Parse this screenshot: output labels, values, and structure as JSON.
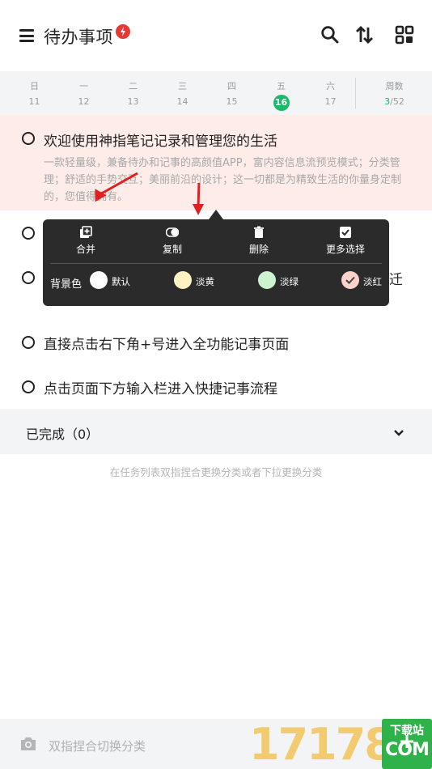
{
  "header": {
    "title": "待办事项",
    "icons": [
      "menu-icon",
      "flash-badge-icon",
      "search-icon",
      "sort-icon",
      "grid-icon"
    ]
  },
  "week": {
    "days": [
      {
        "name": "日",
        "num": "11"
      },
      {
        "name": "一",
        "num": "12"
      },
      {
        "name": "二",
        "num": "13"
      },
      {
        "name": "三",
        "num": "14"
      },
      {
        "name": "四",
        "num": "15"
      },
      {
        "name": "五",
        "num": "16"
      },
      {
        "name": "六",
        "num": "17"
      }
    ],
    "selected_index": 5,
    "weeknum_label": "周数",
    "weeknum_current": "3",
    "weeknum_total": "/52"
  },
  "tasks": [
    {
      "title": "欢迎使用神指笔记记录和管理您的生活",
      "desc": "一款轻量级，兼备待办和记事的高颜值APP，富内容信息流预览模式；分类管理；舒适的手势交互；美丽前沿的设计；这一切都是为精致生活的你量身定制的，您值得拥有。",
      "bg": "#fdece8"
    },
    {
      "title": ""
    },
    {
      "title": "",
      "tail": "迁"
    },
    {
      "title": "直接点击右下角+号进入全功能记事页面"
    },
    {
      "title": "点击页面下方输入栏进入快捷记事流程"
    }
  ],
  "completed": {
    "label": "已完成（0）"
  },
  "hint": "在任务列表双指捏合更换分类或者下拉更换分类",
  "popup": {
    "actions": [
      {
        "label": "合并",
        "icon": "merge-icon"
      },
      {
        "label": "复制",
        "icon": "copy-icon"
      },
      {
        "label": "删除",
        "icon": "trash-icon"
      },
      {
        "label": "更多选择",
        "icon": "checkbox-icon"
      }
    ],
    "bg_label": "背景色",
    "colors": [
      {
        "label": "默认",
        "color": "#ffffff",
        "selected": false
      },
      {
        "label": "淡黄",
        "color": "#fff2c2",
        "selected": false
      },
      {
        "label": "淡绿",
        "color": "#cdf2cf",
        "selected": false
      },
      {
        "label": "淡红",
        "color": "#fdd3cb",
        "selected": true
      }
    ]
  },
  "bottom": {
    "placeholder": "双指捏合切换分类"
  },
  "watermark": {
    "number": "17178",
    "top": "下载站",
    "bottom": "COM"
  }
}
